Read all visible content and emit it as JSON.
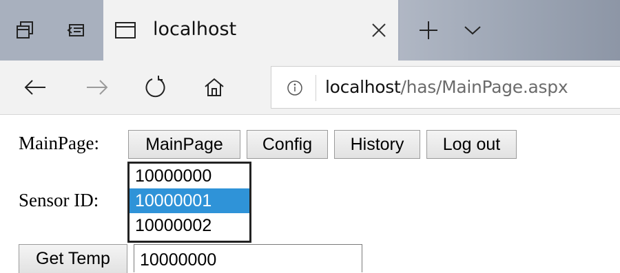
{
  "browser": {
    "tab": {
      "title": "localhost"
    },
    "address": {
      "host": "localhost",
      "path": "/has/MainPage.aspx"
    }
  },
  "page": {
    "heading_label": "MainPage:",
    "nav_buttons": [
      {
        "label": "MainPage"
      },
      {
        "label": "Config"
      },
      {
        "label": "History"
      },
      {
        "label": "Log out"
      }
    ],
    "sensor_label": "Sensor ID:",
    "sensor_options": [
      "10000000",
      "10000001",
      "10000002"
    ],
    "sensor_selected": "10000001",
    "get_temp_label": "Get Temp",
    "temp_value": "10000000"
  },
  "colors": {
    "selection": "#2f93d8",
    "tabstrip": "#a8b0be",
    "chrome": "#f2f2f2"
  }
}
